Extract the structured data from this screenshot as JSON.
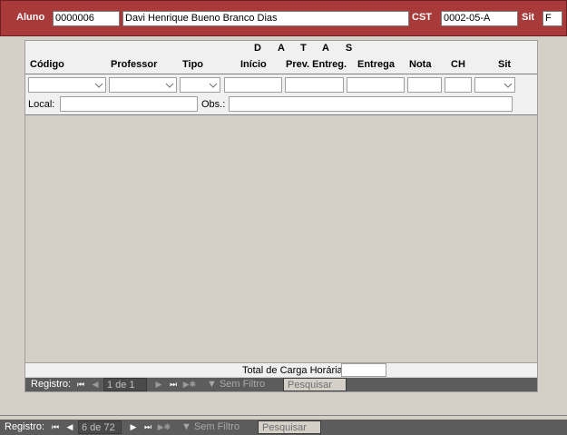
{
  "header": {
    "aluno_label": "Aluno",
    "aluno_code": "0000006",
    "aluno_name": "Davi Henrique Bueno Branco Dias",
    "cst_label": "CST",
    "cst_value": "0002-05-A",
    "sit_label": "Sit",
    "sit_value": "F"
  },
  "grid": {
    "datas_caption": "DATAS",
    "columns": [
      "Código",
      "Professor",
      "Tipo",
      "Início",
      "Prev. Entreg.",
      "Entrega",
      "Nota",
      "CH",
      "Sit"
    ],
    "local_label": "Local:",
    "obs_label": "Obs.:"
  },
  "subform": {
    "total_label": "Total de Carga Horária",
    "total_value": "",
    "nav": {
      "label": "Registro:",
      "counter": "1 de 1",
      "filter": "Sem Filtro",
      "search": "Pesquisar"
    }
  },
  "form_nav": {
    "label": "Registro:",
    "counter": "6 de 72",
    "filter": "Sem Filtro",
    "search": "Pesquisar"
  },
  "colors": {
    "header_bg": "#a83a3a",
    "nav_bg": "#5c5c5c"
  }
}
